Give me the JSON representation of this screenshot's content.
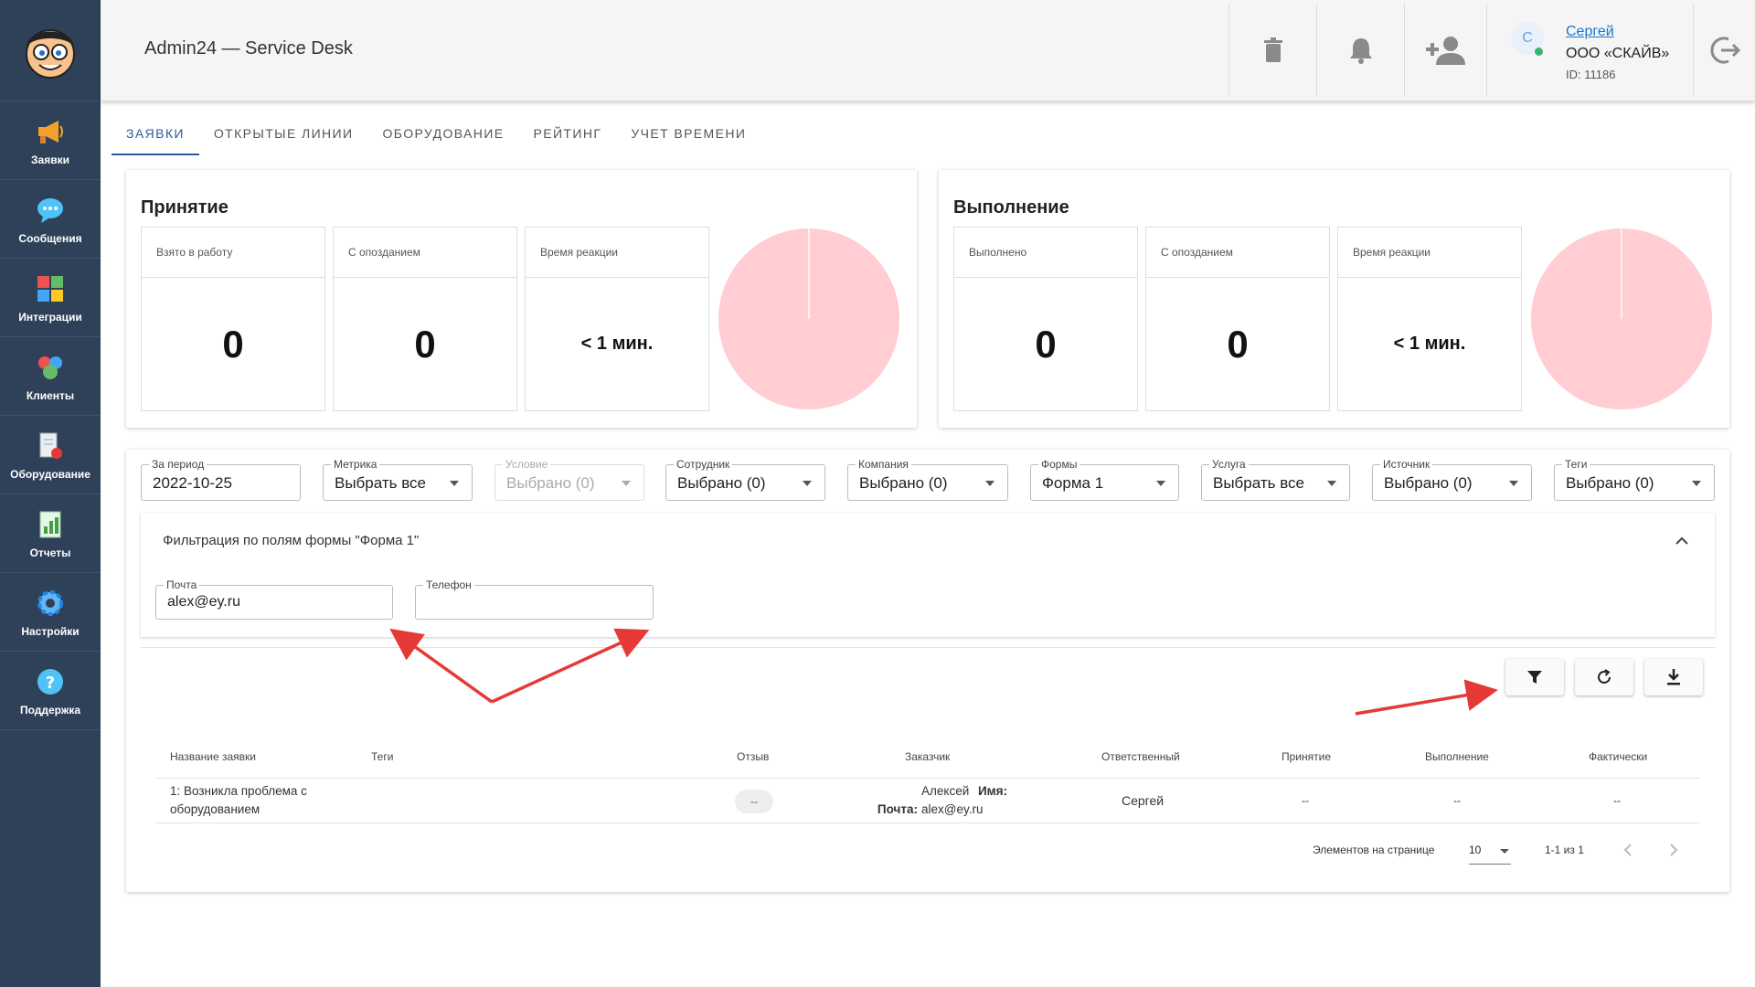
{
  "sidebar": {
    "items": [
      {
        "label": "Заявки",
        "icon": "megaphone-icon"
      },
      {
        "label": "Сообщения",
        "icon": "chat-bubble-icon"
      },
      {
        "label": "Интеграции",
        "icon": "puzzle-icon"
      },
      {
        "label": "Клиенты",
        "icon": "users-group-icon"
      },
      {
        "label": "Оборудование",
        "icon": "equipment-icon"
      },
      {
        "label": "Отчеты",
        "icon": "report-chart-icon"
      },
      {
        "label": "Настройки",
        "icon": "gear-icon"
      },
      {
        "label": "Поддержка",
        "icon": "help-icon"
      }
    ]
  },
  "header": {
    "title": "Admin24 — Service Desk",
    "user": {
      "initial": "С",
      "name": "Сергей",
      "company": "ООО «СКАЙВ»",
      "id": "ID: 11186"
    }
  },
  "tabs": [
    {
      "label": "ЗАЯВКИ",
      "active": true
    },
    {
      "label": "ОТКРЫТЫЕ ЛИНИИ",
      "active": false
    },
    {
      "label": "ОБОРУДОВАНИЕ",
      "active": false
    },
    {
      "label": "РЕЙТИНГ",
      "active": false
    },
    {
      "label": "УЧЕТ ВРЕМЕНИ",
      "active": false
    }
  ],
  "acceptance": {
    "title": "Принятие",
    "stats": [
      {
        "label": "Взято в работу",
        "value": "0"
      },
      {
        "label": "С опозданием",
        "value": "0"
      },
      {
        "label": "Время реакции",
        "value": "< 1 мин."
      }
    ]
  },
  "completion": {
    "title": "Выполнение",
    "stats": [
      {
        "label": "Выполнено",
        "value": "0"
      },
      {
        "label": "С опозданием",
        "value": "0"
      },
      {
        "label": "Время реакции",
        "value": "< 1 мин."
      }
    ]
  },
  "filters": {
    "period": {
      "label": "За период",
      "value": "2022-10-25"
    },
    "metric": {
      "label": "Метрика",
      "value": "Выбрать все"
    },
    "condition": {
      "label": "Условие",
      "value": "Выбрано (0)"
    },
    "employee": {
      "label": "Сотрудник",
      "value": "Выбрано (0)"
    },
    "company": {
      "label": "Компания",
      "value": "Выбрано (0)"
    },
    "forms": {
      "label": "Формы",
      "value": "Форма 1"
    },
    "service": {
      "label": "Услуга",
      "value": "Выбрать все"
    },
    "source": {
      "label": "Источник",
      "value": "Выбрано (0)"
    },
    "tags": {
      "label": "Теги",
      "value": "Выбрано (0)"
    }
  },
  "form_filter": {
    "title": "Фильтрация по полям формы \"Форма 1\"",
    "email": {
      "label": "Почта",
      "value": "alex@ey.ru"
    },
    "phone": {
      "label": "Телефон",
      "value": ""
    }
  },
  "table": {
    "headers": [
      "Название заявки",
      "Теги",
      "Отзыв",
      "Заказчик",
      "Ответственный",
      "Принятие",
      "Выполнение",
      "Фактически"
    ],
    "rows": [
      {
        "name_line1": "1: Возникла проблема с",
        "name_line2": "оборудованием",
        "tags": "",
        "review": "--",
        "customer_name_label": "Имя:",
        "customer_name": "Алексей",
        "customer_email_label": "Почта:",
        "customer_email": "alex@ey.ru",
        "responsible": "Сергей",
        "acceptance": "--",
        "completion": "--",
        "actual": "--"
      }
    ]
  },
  "pagination": {
    "per_page_label": "Элементов на странице",
    "per_page_value": "10",
    "range": "1-1 из 1"
  },
  "colors": {
    "sidebar": "#2f4159",
    "accent": "#2b5a9a",
    "pie": "#ffcdd2",
    "annotation_arrow": "#e53935"
  }
}
